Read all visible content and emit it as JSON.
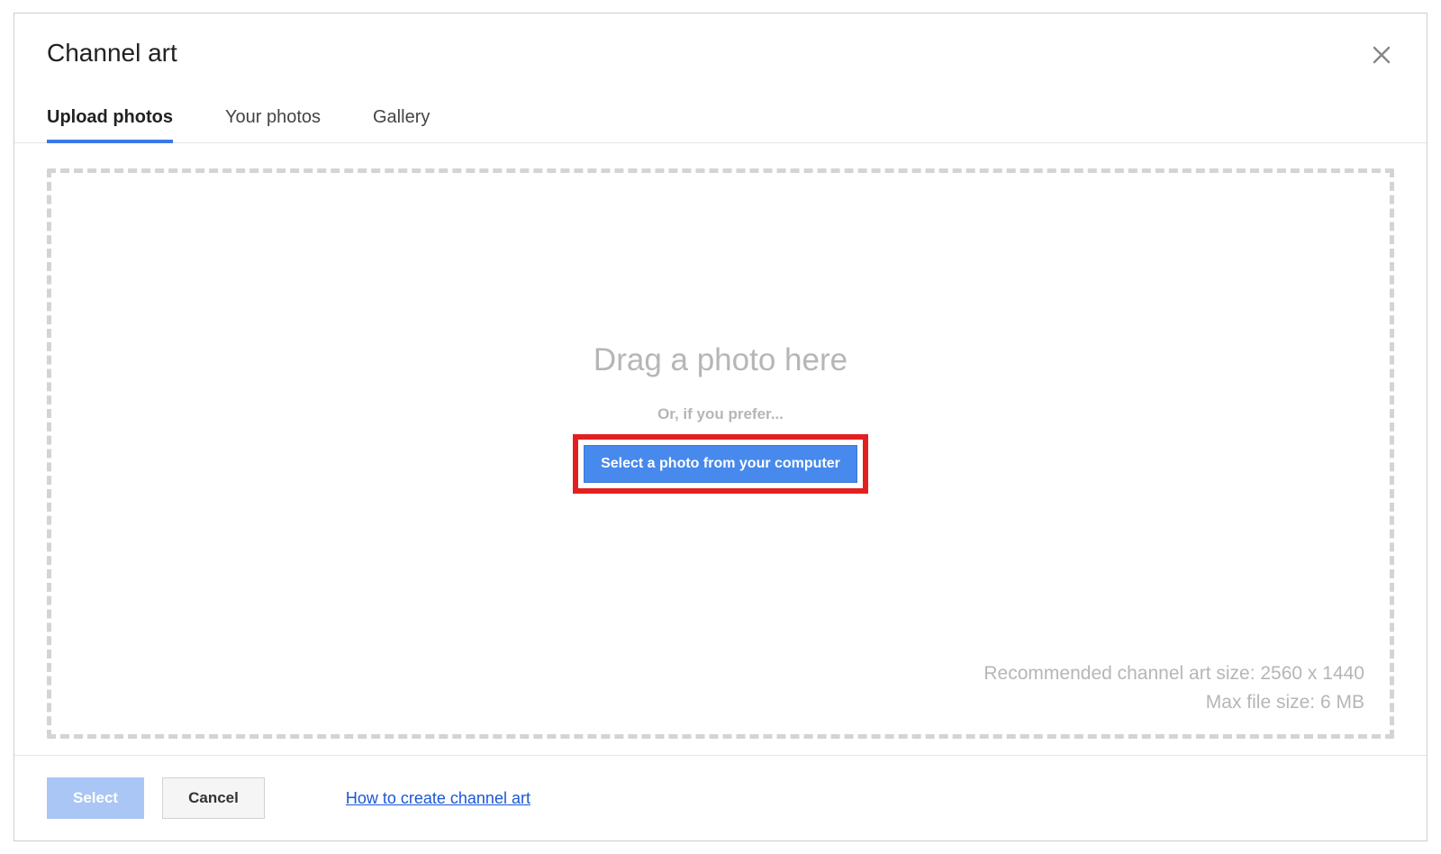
{
  "header": {
    "title": "Channel art"
  },
  "tabs": {
    "upload": "Upload photos",
    "your_photos": "Your photos",
    "gallery": "Gallery"
  },
  "drop": {
    "drag_text": "Drag a photo here",
    "or_text": "Or, if you prefer...",
    "select_button": "Select a photo from your computer",
    "recommended": "Recommended channel art size: 2560 x 1440",
    "max_size": "Max file size: 6 MB"
  },
  "footer": {
    "select": "Select",
    "cancel": "Cancel",
    "help_link": "How to create channel art"
  }
}
